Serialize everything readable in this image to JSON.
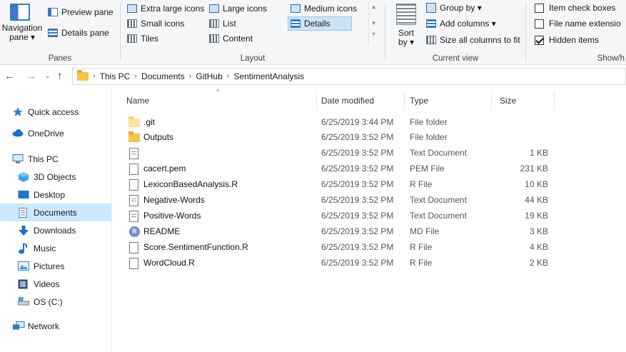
{
  "ribbon": {
    "panes": {
      "group_label": "Panes",
      "navigation_pane_line1": "Navigation",
      "navigation_pane_line2": "pane ▾",
      "preview_pane": "Preview pane",
      "details_pane": "Details pane"
    },
    "layout": {
      "group_label": "Layout",
      "options": [
        "Extra large icons",
        "Large icons",
        "Medium icons",
        "Small icons",
        "List",
        "Details",
        "Tiles",
        "Content"
      ],
      "selected": "Details"
    },
    "current_view": {
      "group_label": "Current view",
      "sort_line1": "Sort",
      "sort_line2": "by ▾",
      "group_by": "Group by ▾",
      "add_columns": "Add columns ▾",
      "size_all_columns": "Size all columns to fit"
    },
    "show_hide": {
      "group_label": "Show/h",
      "item_check_boxes": "Item check boxes",
      "item_check_boxes_checked": false,
      "file_name_extensions": "File name extensio",
      "file_name_extensions_checked": false,
      "hidden_items": "Hidden items",
      "hidden_items_checked": true
    }
  },
  "address": {
    "breadcrumbs": [
      "This PC",
      "Documents",
      "GitHub",
      "SentimentAnalysis"
    ]
  },
  "sidebar": {
    "items": [
      {
        "label": "Quick access",
        "icon": "star-icon"
      },
      {
        "label": "OneDrive",
        "icon": "cloud-icon"
      },
      {
        "label": "This PC",
        "icon": "computer-icon"
      },
      {
        "label": "3D Objects",
        "icon": "cube-icon"
      },
      {
        "label": "Desktop",
        "icon": "desktop-icon"
      },
      {
        "label": "Documents",
        "icon": "documents-icon",
        "selected": true
      },
      {
        "label": "Downloads",
        "icon": "download-icon"
      },
      {
        "label": "Music",
        "icon": "music-icon"
      },
      {
        "label": "Pictures",
        "icon": "pictures-icon"
      },
      {
        "label": "Videos",
        "icon": "videos-icon"
      },
      {
        "label": "OS (C:)",
        "icon": "drive-icon"
      },
      {
        "label": "Network",
        "icon": "network-icon"
      }
    ]
  },
  "files": {
    "columns": {
      "name": "Name",
      "date": "Date modified",
      "type": "Type",
      "size": "Size"
    },
    "rows": [
      {
        "name": ".git",
        "date": "6/25/2019 3:44 PM",
        "type": "File folder",
        "size": "",
        "icon": "folder-light-icon"
      },
      {
        "name": "Outputs",
        "date": "6/25/2019 3:52 PM",
        "type": "File folder",
        "size": "",
        "icon": "folder-icon"
      },
      {
        "name": "",
        "date": "6/25/2019 3:52 PM",
        "type": "Text Document",
        "size": "1 KB",
        "icon": "text-document-icon"
      },
      {
        "name": "cacert.pem",
        "date": "6/25/2019 3:52 PM",
        "type": "PEM File",
        "size": "231 KB",
        "icon": "file-icon"
      },
      {
        "name": "LexiconBasedAnalysis.R",
        "date": "6/25/2019 3:52 PM",
        "type": "R File",
        "size": "10 KB",
        "icon": "file-icon"
      },
      {
        "name": "Negative-Words",
        "date": "6/25/2019 3:52 PM",
        "type": "Text Document",
        "size": "44 KB",
        "icon": "text-document-icon"
      },
      {
        "name": "Positive-Words",
        "date": "6/25/2019 3:52 PM",
        "type": "Text Document",
        "size": "19 KB",
        "icon": "text-document-icon"
      },
      {
        "name": "README",
        "date": "6/25/2019 3:52 PM",
        "type": "MD File",
        "size": "3 KB",
        "icon": "r-logo-icon"
      },
      {
        "name": "Score.SentimentFunction.R",
        "date": "6/25/2019 3:52 PM",
        "type": "R File",
        "size": "4 KB",
        "icon": "file-icon"
      },
      {
        "name": "WordCloud.R",
        "date": "6/25/2019 3:52 PM",
        "type": "R File",
        "size": "2 KB",
        "icon": "file-icon"
      }
    ]
  }
}
